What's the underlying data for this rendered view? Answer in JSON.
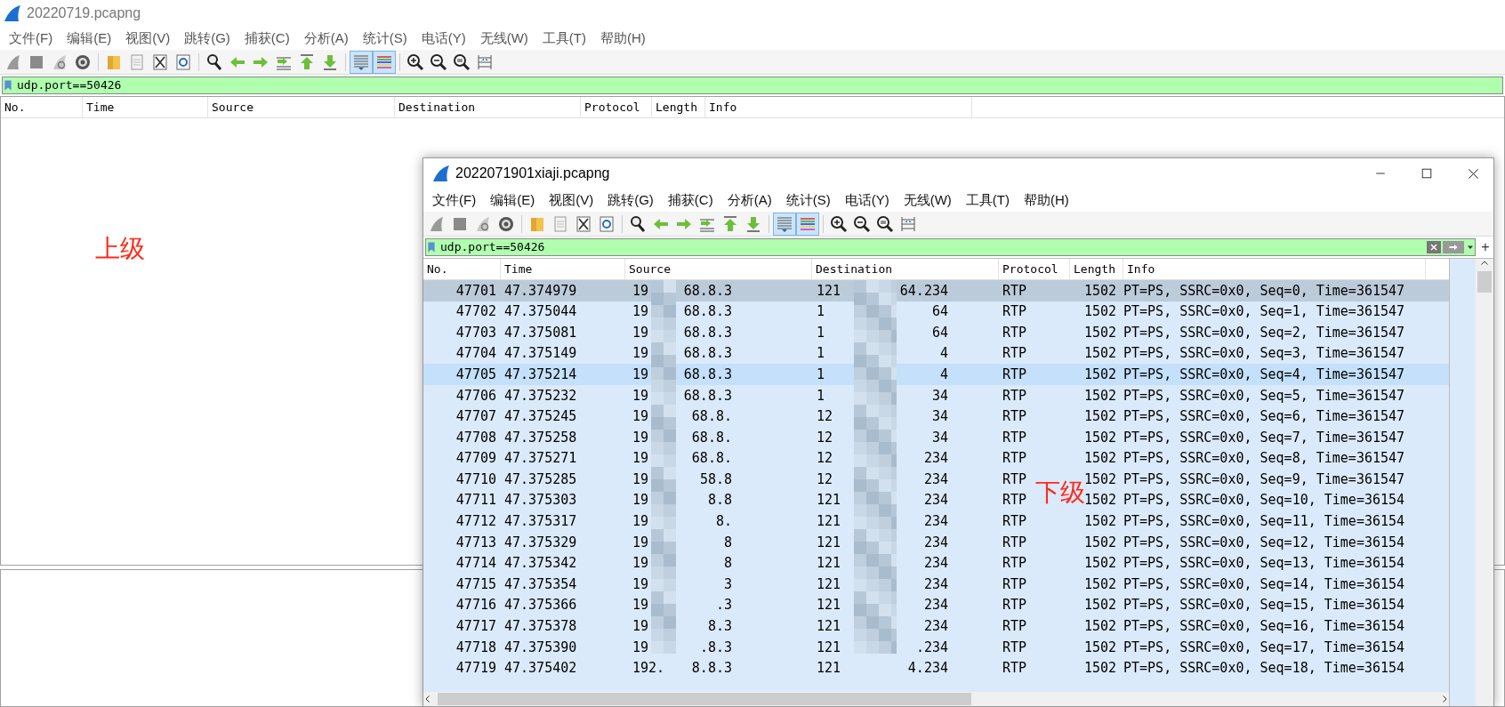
{
  "outer_window": {
    "title": "20220719.pcapng",
    "menu": [
      "文件(F)",
      "编辑(E)",
      "视图(V)",
      "跳转(G)",
      "捕获(C)",
      "分析(A)",
      "统计(S)",
      "电话(Y)",
      "无线(W)",
      "工具(T)",
      "帮助(H)"
    ],
    "toolbar": [
      {
        "pressed": false
      },
      {
        "pressed": false
      },
      {
        "pressed": false
      },
      {
        "pressed": false
      },
      {
        "pressed": false
      },
      {
        "pressed": false
      },
      {
        "pressed": false
      },
      {
        "pressed": false
      },
      {
        "pressed": false
      },
      {
        "pressed": false
      },
      {
        "pressed": false
      },
      {
        "pressed": false
      },
      {
        "pressed": false
      },
      {
        "pressed": false
      },
      {
        "pressed": true
      },
      {
        "pressed": true
      },
      {
        "pressed": false
      },
      {
        "pressed": false
      },
      {
        "pressed": false
      },
      {
        "pressed": false
      }
    ],
    "filter": "udp.port==50426",
    "columns": [
      "No.",
      "Time",
      "Source",
      "Destination",
      "Protocol",
      "Length",
      "Info"
    ],
    "annotation": "上级"
  },
  "inner_window": {
    "title": "2022071901xiaji.pcapng",
    "menu": [
      "文件(F)",
      "编辑(E)",
      "视图(V)",
      "跳转(G)",
      "捕获(C)",
      "分析(A)",
      "统计(S)",
      "电话(Y)",
      "无线(W)",
      "工具(T)",
      "帮助(H)"
    ],
    "toolbar": [
      {
        "pressed": false
      },
      {
        "pressed": false
      },
      {
        "pressed": false
      },
      {
        "pressed": false
      },
      {
        "pressed": false
      },
      {
        "pressed": false
      },
      {
        "pressed": false
      },
      {
        "pressed": false
      },
      {
        "pressed": false
      },
      {
        "pressed": false
      },
      {
        "pressed": false
      },
      {
        "pressed": false
      },
      {
        "pressed": false
      },
      {
        "pressed": false
      },
      {
        "pressed": true
      },
      {
        "pressed": true
      },
      {
        "pressed": false
      },
      {
        "pressed": false
      },
      {
        "pressed": false
      },
      {
        "pressed": false
      }
    ],
    "filter": "udp.port==50426",
    "add_filter": "+",
    "columns": [
      "No.",
      "Time",
      "Source",
      "Destination",
      "Protocol",
      "Length",
      "Info"
    ],
    "rows": [
      {
        "no": "47701",
        "time": "47.374979",
        "source": [
          "19",
          "68.8.3"
        ],
        "destination": [
          "121",
          "64.234"
        ],
        "protocol": "RTP",
        "length": "1502",
        "info": "PT=PS, SSRC=0x0, Seq=0, Time=361547",
        "selected": true,
        "hovered": false
      },
      {
        "no": "47702",
        "time": "47.375044",
        "source": [
          "19",
          "68.8.3"
        ],
        "destination": [
          "1",
          "64"
        ],
        "protocol": "RTP",
        "length": "1502",
        "info": "PT=PS, SSRC=0x0, Seq=1, Time=361547",
        "selected": false,
        "hovered": false
      },
      {
        "no": "47703",
        "time": "47.375081",
        "source": [
          "19",
          "68.8.3"
        ],
        "destination": [
          "1",
          "64"
        ],
        "protocol": "RTP",
        "length": "1502",
        "info": "PT=PS, SSRC=0x0, Seq=2, Time=361547",
        "selected": false,
        "hovered": false
      },
      {
        "no": "47704",
        "time": "47.375149",
        "source": [
          "19",
          "68.8.3"
        ],
        "destination": [
          "1",
          "4"
        ],
        "protocol": "RTP",
        "length": "1502",
        "info": "PT=PS, SSRC=0x0, Seq=3, Time=361547",
        "selected": false,
        "hovered": false
      },
      {
        "no": "47705",
        "time": "47.375214",
        "source": [
          "19",
          "68.8.3"
        ],
        "destination": [
          "1",
          "4"
        ],
        "protocol": "RTP",
        "length": "1502",
        "info": "PT=PS, SSRC=0x0, Seq=4, Time=361547",
        "selected": false,
        "hovered": true
      },
      {
        "no": "47706",
        "time": "47.375232",
        "source": [
          "19",
          "68.8.3"
        ],
        "destination": [
          "1",
          "34"
        ],
        "protocol": "RTP",
        "length": "1502",
        "info": "PT=PS, SSRC=0x0, Seq=5, Time=361547",
        "selected": false,
        "hovered": false
      },
      {
        "no": "47707",
        "time": "47.375245",
        "source": [
          "19",
          "68.8."
        ],
        "destination": [
          "12",
          "34"
        ],
        "protocol": "RTP",
        "length": "1502",
        "info": "PT=PS, SSRC=0x0, Seq=6, Time=361547",
        "selected": false,
        "hovered": false
      },
      {
        "no": "47708",
        "time": "47.375258",
        "source": [
          "19",
          "68.8."
        ],
        "destination": [
          "12",
          "34"
        ],
        "protocol": "RTP",
        "length": "1502",
        "info": "PT=PS, SSRC=0x0, Seq=7, Time=361547",
        "selected": false,
        "hovered": false
      },
      {
        "no": "47709",
        "time": "47.375271",
        "source": [
          "19",
          "68.8."
        ],
        "destination": [
          "12",
          "234"
        ],
        "protocol": "RTP",
        "length": "1502",
        "info": "PT=PS, SSRC=0x0, Seq=8, Time=361547",
        "selected": false,
        "hovered": false
      },
      {
        "no": "47710",
        "time": "47.375285",
        "source": [
          "19",
          "58.8"
        ],
        "destination": [
          "12",
          "234"
        ],
        "protocol": "RTP",
        "length": "1502",
        "info": "PT=PS, SSRC=0x0, Seq=9, Time=361547",
        "selected": false,
        "hovered": false
      },
      {
        "no": "47711",
        "time": "47.375303",
        "source": [
          "19",
          "8.8"
        ],
        "destination": [
          "121",
          "234"
        ],
        "protocol": "RTP",
        "length": "1502",
        "info": "PT=PS, SSRC=0x0, Seq=10, Time=36154",
        "selected": false,
        "hovered": false
      },
      {
        "no": "47712",
        "time": "47.375317",
        "source": [
          "19",
          "8."
        ],
        "destination": [
          "121",
          "234"
        ],
        "protocol": "RTP",
        "length": "1502",
        "info": "PT=PS, SSRC=0x0, Seq=11, Time=36154",
        "selected": false,
        "hovered": false
      },
      {
        "no": "47713",
        "time": "47.375329",
        "source": [
          "19",
          "8"
        ],
        "destination": [
          "121",
          "234"
        ],
        "protocol": "RTP",
        "length": "1502",
        "info": "PT=PS, SSRC=0x0, Seq=12, Time=36154",
        "selected": false,
        "hovered": false
      },
      {
        "no": "47714",
        "time": "47.375342",
        "source": [
          "19",
          "8"
        ],
        "destination": [
          "121",
          "234"
        ],
        "protocol": "RTP",
        "length": "1502",
        "info": "PT=PS, SSRC=0x0, Seq=13, Time=36154",
        "selected": false,
        "hovered": false
      },
      {
        "no": "47715",
        "time": "47.375354",
        "source": [
          "19",
          "3"
        ],
        "destination": [
          "121",
          "234"
        ],
        "protocol": "RTP",
        "length": "1502",
        "info": "PT=PS, SSRC=0x0, Seq=14, Time=36154",
        "selected": false,
        "hovered": false
      },
      {
        "no": "47716",
        "time": "47.375366",
        "source": [
          "19",
          ".3"
        ],
        "destination": [
          "121",
          "234"
        ],
        "protocol": "RTP",
        "length": "1502",
        "info": "PT=PS, SSRC=0x0, Seq=15, Time=36154",
        "selected": false,
        "hovered": false
      },
      {
        "no": "47717",
        "time": "47.375378",
        "source": [
          "19",
          "8.3"
        ],
        "destination": [
          "121",
          "234"
        ],
        "protocol": "RTP",
        "length": "1502",
        "info": "PT=PS, SSRC=0x0, Seq=16, Time=36154",
        "selected": false,
        "hovered": false
      },
      {
        "no": "47718",
        "time": "47.375390",
        "source": [
          "19",
          ".8.3"
        ],
        "destination": [
          "121",
          ".234"
        ],
        "protocol": "RTP",
        "length": "1502",
        "info": "PT=PS, SSRC=0x0, Seq=17, Time=36154",
        "selected": false,
        "hovered": false
      },
      {
        "no": "47719",
        "time": "47.375402",
        "source": [
          "192.",
          "8.8.3"
        ],
        "destination": [
          "121",
          "4.234"
        ],
        "protocol": "RTP",
        "length": "1502",
        "info": "PT=PS, SSRC=0x0, Seq=18, Time=36154",
        "selected": false,
        "hovered": false
      }
    ],
    "annotation": "下级"
  }
}
